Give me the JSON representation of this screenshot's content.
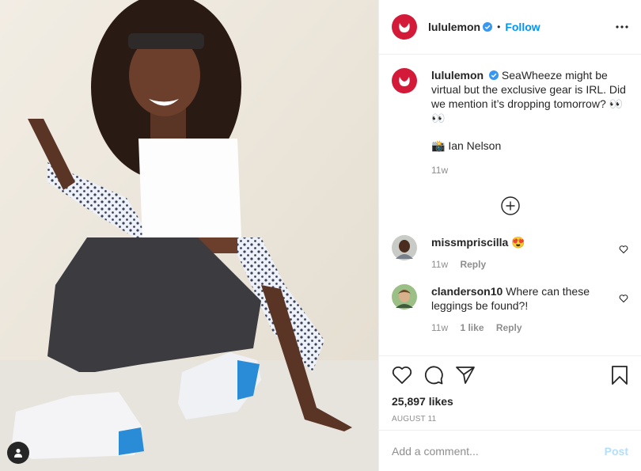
{
  "post": {
    "username": "lululemon",
    "follow_label": "Follow",
    "separator": "•",
    "more_icon": "more-horizontal-icon",
    "caption": "SeaWheeze might be virtual but the exclusive gear is IRL. Did we mention it’s dropping tomorrow? 👀👀",
    "photo_credit": "📸 Ian Nelson",
    "caption_time": "11w",
    "likes": "25,897 likes",
    "date": "AUGUST 11"
  },
  "comments": [
    {
      "username": "missmpriscilla",
      "text": "😍",
      "time": "11w",
      "likes": "",
      "reply": "Reply"
    },
    {
      "username": "clanderson10",
      "text": "Where can these leggings be found?!",
      "time": "11w",
      "likes": "1 like",
      "reply": "Reply"
    }
  ],
  "composer": {
    "placeholder": "Add a comment...",
    "post_label": "Post"
  },
  "colors": {
    "brand": "#d31a38",
    "link": "#0095f6",
    "post_disabled": "#b2dffc",
    "muted": "#8e8e8e"
  }
}
